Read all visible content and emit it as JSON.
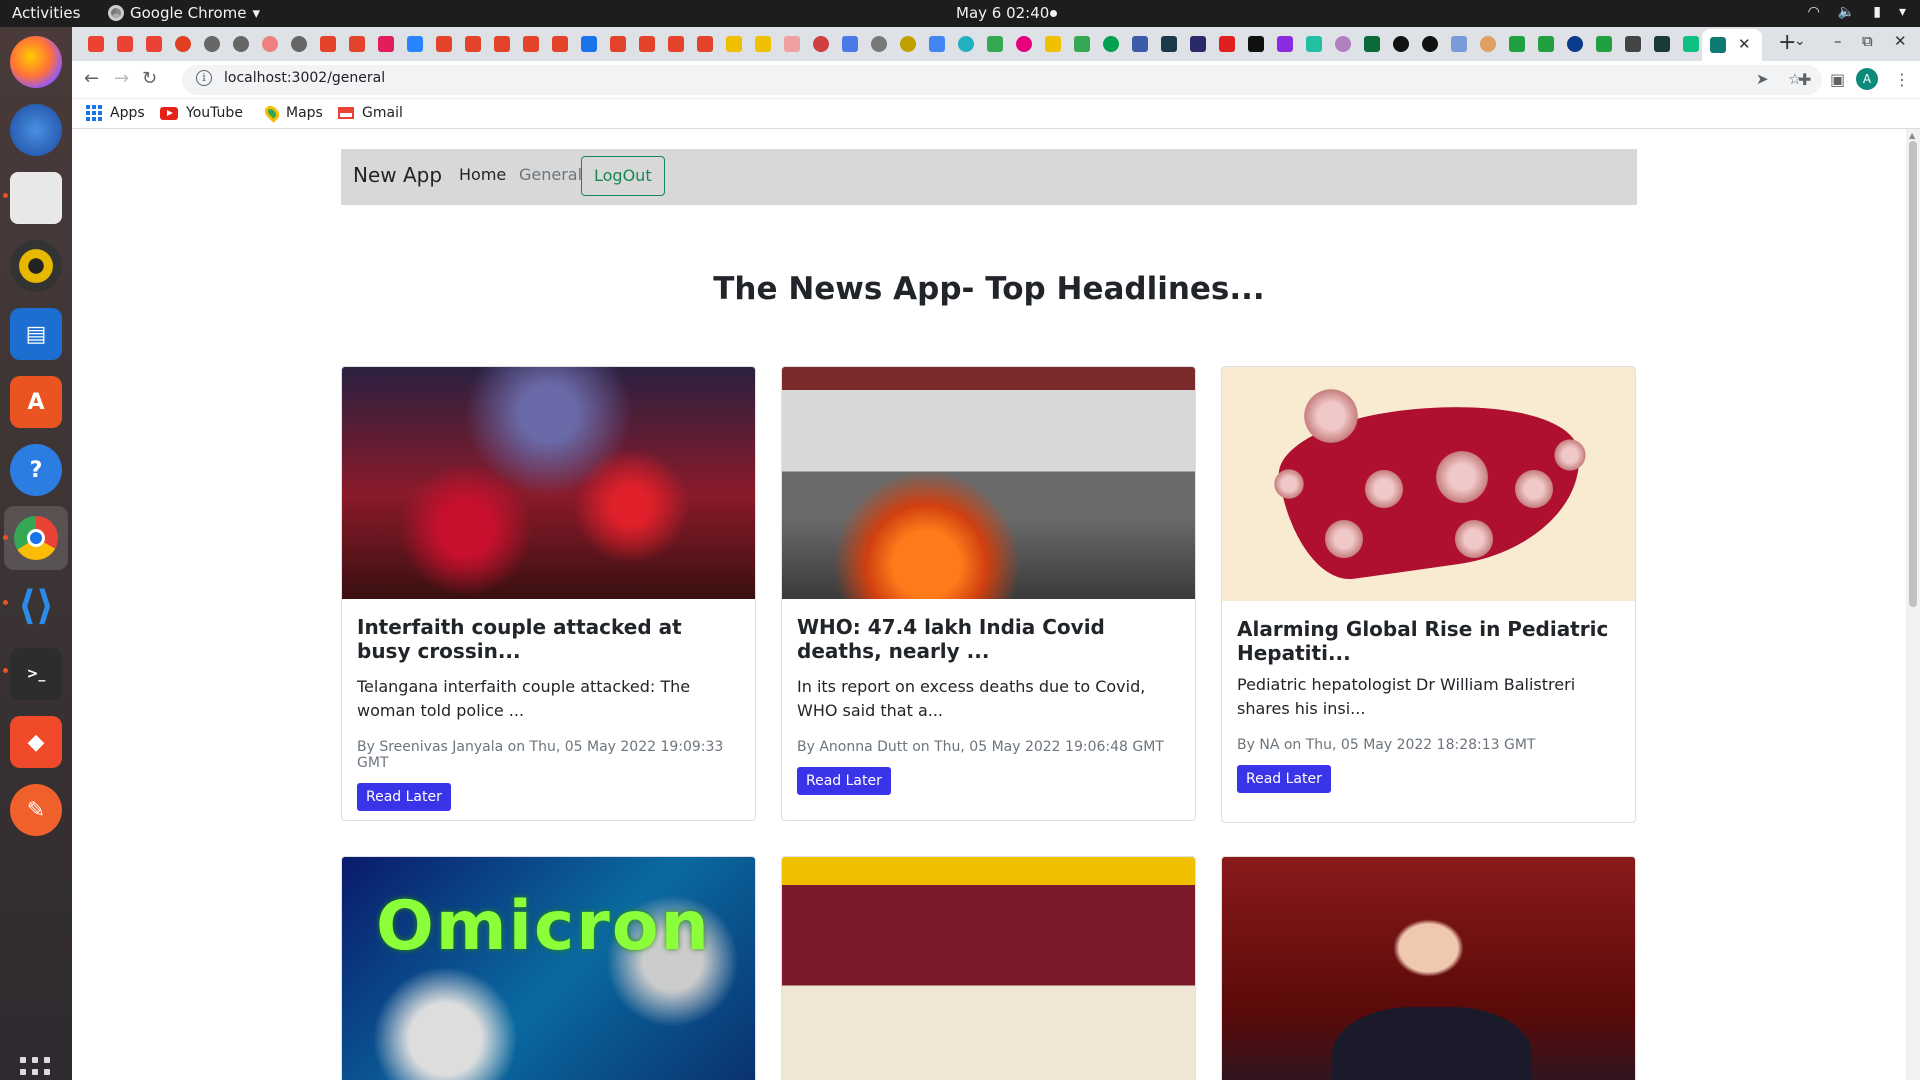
{
  "system_bar": {
    "activities": "Activities",
    "app_name": "Google Chrome",
    "clock": "May 6  02:40"
  },
  "browser": {
    "url": "localhost:3002/general",
    "bookmarks": [
      "Apps",
      "YouTube",
      "Maps",
      "Gmail"
    ],
    "avatar_letter": "A",
    "accent": "#0f7a71"
  },
  "navbar": {
    "brand": "New App",
    "home": "Home",
    "general": "General",
    "logout": "LogOut"
  },
  "page": {
    "headline": "The News App- Top Headlines..."
  },
  "articles": [
    {
      "title": "Interfaith couple attacked at busy crossin...",
      "description": "Telangana interfaith couple attacked: The woman told police ...",
      "meta": "By Sreenivas Janyala on Thu, 05 May 2022 19:09:33 GMT",
      "button": "Read Later"
    },
    {
      "title": "WHO: 47.4 lakh India Covid deaths, nearly ...",
      "description": "In its report on excess deaths due to Covid, WHO said that a...",
      "meta": "By Anonna Dutt on Thu, 05 May 2022 19:06:48 GMT",
      "button": "Read Later"
    },
    {
      "title": "Alarming Global Rise in Pediatric Hepatiti...",
      "description": "Pediatric hepatologist Dr William Balistreri shares his insi...",
      "meta": "By NA on Thu, 05 May 2022 18:28:13 GMT",
      "button": "Read Later"
    }
  ],
  "image_texts": {
    "omicron": "Omicron"
  },
  "colors": {
    "read_later_button": "#3a34e8",
    "logout_outline": "#198754",
    "navbar_bg": "#d8d8d8"
  }
}
